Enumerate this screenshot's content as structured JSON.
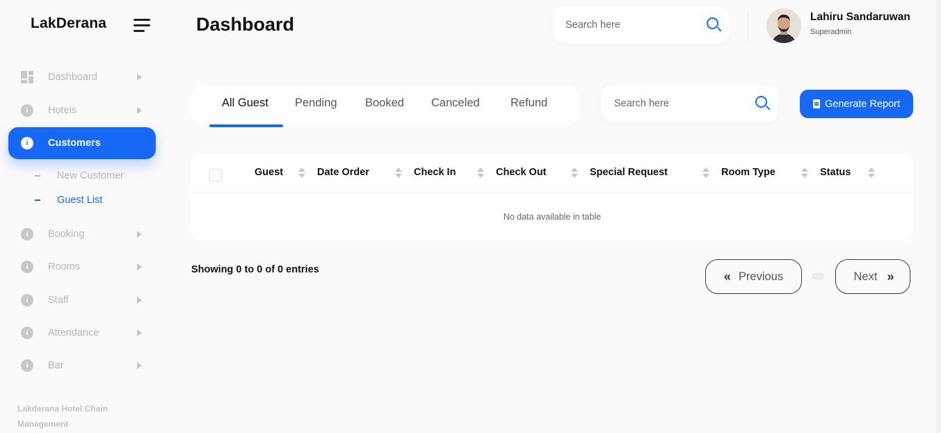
{
  "brand": "LakDerana",
  "sidebar": {
    "items": [
      {
        "label": "Dashboard"
      },
      {
        "label": "Hotels"
      },
      {
        "label": "Customers"
      },
      {
        "label": "Booking"
      },
      {
        "label": "Rooms"
      },
      {
        "label": "Staff"
      },
      {
        "label": "Attendance"
      },
      {
        "label": "Bar"
      }
    ],
    "sub_items": [
      {
        "label": "New Customer"
      },
      {
        "label": "Guest List"
      }
    ],
    "footer": "Lakderana Hotel Chain Management",
    "icon_glyph": "i"
  },
  "header": {
    "title": "Dashboard",
    "search_placeholder": "Search here",
    "user_name": "Lahiru Sandaruwan",
    "user_role": "Superadmin"
  },
  "tabs": [
    {
      "label": "All Guest"
    },
    {
      "label": "Pending"
    },
    {
      "label": "Booked"
    },
    {
      "label": "Canceled"
    },
    {
      "label": "Refund"
    }
  ],
  "filter": {
    "search_placeholder": "Search here",
    "report_label": "Generate Report"
  },
  "table": {
    "columns": [
      "Guest",
      "Date Order",
      "Check In",
      "Check Out",
      "Special Request",
      "Room Type",
      "Status"
    ],
    "empty_message": "No data available in table"
  },
  "pagination": {
    "info": "Showing 0 to 0 of 0 entries",
    "previous": "Previous",
    "next": "Next",
    "prev_glyph": "«",
    "next_glyph": "»"
  },
  "colors": {
    "accent": "#1668f5",
    "background": "#fafafa",
    "muted": "#b5b5b5"
  }
}
